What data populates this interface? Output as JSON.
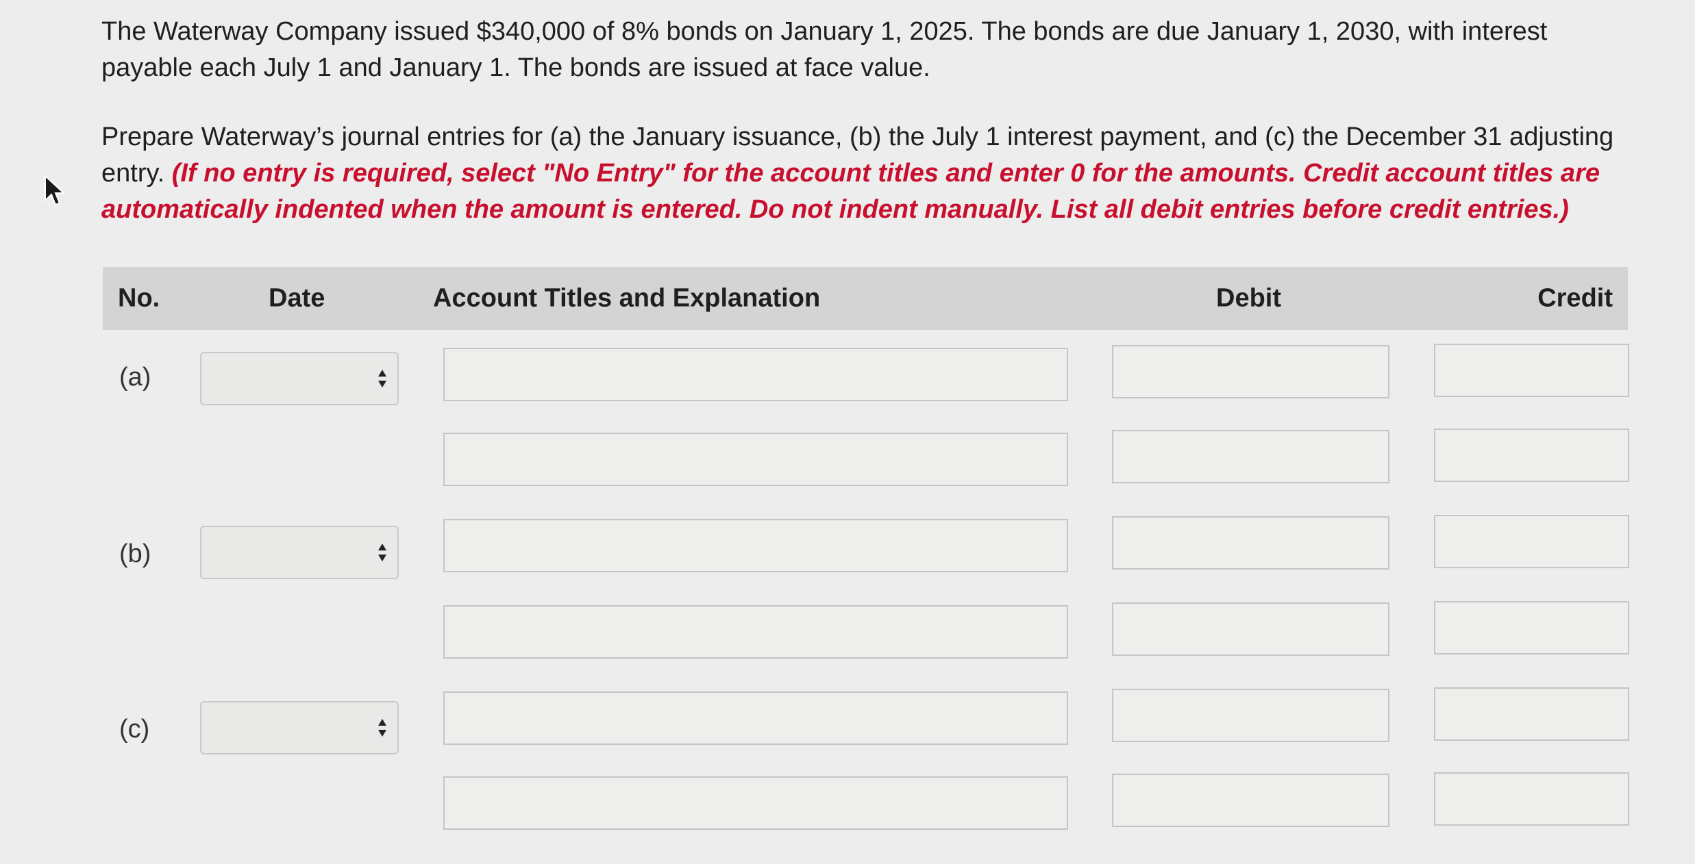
{
  "problem": {
    "paragraph1": "The Waterway Company issued $340,000 of 8% bonds on January 1, 2025. The bonds are due January 1, 2030, with interest payable each July 1 and January 1. The bonds are issued at face value.",
    "paragraph2_text": "Prepare Waterway’s journal entries for (a) the January issuance, (b) the July 1 interest payment, and (c) the December 31 adjusting entry. ",
    "paragraph2_instruction": "(If no entry is required, select \"No Entry\" for the account titles and enter 0 for the amounts. Credit account titles are automatically indented when the amount is entered. Do not indent manually. List all debit entries before credit entries.)"
  },
  "table": {
    "headers": {
      "no": "No.",
      "date": "Date",
      "account": "Account Titles and Explanation",
      "debit": "Debit",
      "credit": "Credit"
    },
    "entries": [
      {
        "label": "(a)",
        "date_value": "",
        "lines": [
          {
            "account": "",
            "debit": "",
            "credit": ""
          },
          {
            "account": "",
            "debit": "",
            "credit": ""
          }
        ]
      },
      {
        "label": "(b)",
        "date_value": "",
        "lines": [
          {
            "account": "",
            "debit": "",
            "credit": ""
          },
          {
            "account": "",
            "debit": "",
            "credit": ""
          }
        ]
      },
      {
        "label": "(c)",
        "date_value": "",
        "lines": [
          {
            "account": "",
            "debit": "",
            "credit": ""
          },
          {
            "account": "",
            "debit": "",
            "credit": ""
          }
        ]
      }
    ]
  },
  "icons": {
    "cursor": "mouse-pointer-icon",
    "select_arrows": "select-arrows-icon"
  },
  "colors": {
    "instruction_red": "#c8102e",
    "header_bg": "#d3d4d3",
    "page_bg": "#ecedec"
  }
}
